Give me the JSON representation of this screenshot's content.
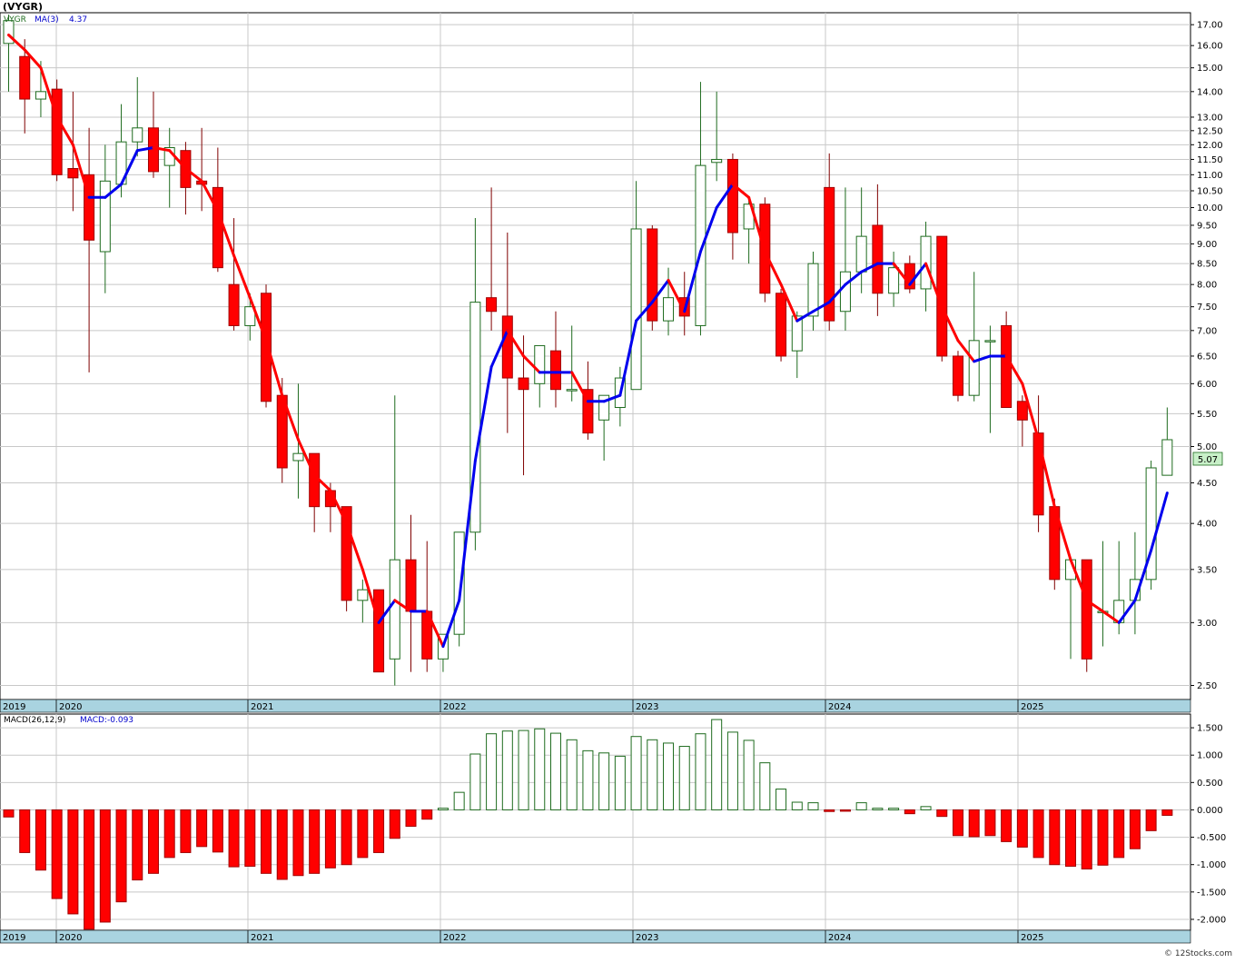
{
  "header": {
    "title": "(VYGR)",
    "legend_symbol": "VYGR",
    "legend_ma": "MA(3)",
    "legend_ma_value": "4.37",
    "last_price": "5.07",
    "watermark": "© 12Stocks.com"
  },
  "macd_panel": {
    "label": "MACD(26,12,9)",
    "value_label": "MACD:-0.093"
  },
  "colors": {
    "up": "#1e6b1e",
    "down": "#ff0000",
    "ma_up": "#0000ee",
    "ma_down": "#ff0000",
    "axis_band": "#a9d3e0",
    "grid": "#c8c8c8",
    "price_tag": "#c8f0c8"
  },
  "chart_data": [
    {
      "type": "candlestick",
      "title": "",
      "frequency": "monthly",
      "scale": "log",
      "ylim": [
        2.4,
        17.6
      ],
      "y_ticks": [
        "17.00",
        "16.00",
        "15.00",
        "14.00",
        "13.00",
        "12.50",
        "12.00",
        "11.50",
        "11.00",
        "10.50",
        "10.00",
        "9.50",
        "9.00",
        "8.50",
        "8.00",
        "7.50",
        "7.00",
        "6.50",
        "6.00",
        "5.50",
        "5.00",
        "4.50",
        "4.00",
        "3.50",
        "3.00",
        "2.50"
      ],
      "x_labels": [
        "2019",
        "2020",
        "2021",
        "2022",
        "2023",
        "2024",
        "2025"
      ],
      "series_ohlc": [
        {
          "o": 16.1,
          "h": 17.5,
          "l": 14.0,
          "c": 17.2
        },
        {
          "o": 15.5,
          "h": 16.3,
          "l": 12.4,
          "c": 13.7
        },
        {
          "o": 13.7,
          "h": 15.3,
          "l": 13.0,
          "c": 14.0
        },
        {
          "o": 14.1,
          "h": 14.5,
          "l": 10.8,
          "c": 11.0
        },
        {
          "o": 11.2,
          "h": 14.0,
          "l": 9.9,
          "c": 10.9
        },
        {
          "o": 11.0,
          "h": 12.6,
          "l": 6.2,
          "c": 9.1
        },
        {
          "o": 8.8,
          "h": 12.0,
          "l": 7.8,
          "c": 10.8
        },
        {
          "o": 10.7,
          "h": 13.5,
          "l": 10.3,
          "c": 12.1
        },
        {
          "o": 12.1,
          "h": 14.6,
          "l": 11.6,
          "c": 12.6
        },
        {
          "o": 12.6,
          "h": 14.0,
          "l": 10.9,
          "c": 11.1
        },
        {
          "o": 11.3,
          "h": 12.6,
          "l": 10.0,
          "c": 11.9
        },
        {
          "o": 11.8,
          "h": 12.1,
          "l": 9.8,
          "c": 10.6
        },
        {
          "o": 10.8,
          "h": 12.6,
          "l": 9.9,
          "c": 10.7
        },
        {
          "o": 10.6,
          "h": 11.9,
          "l": 8.3,
          "c": 8.4
        },
        {
          "o": 8.0,
          "h": 9.7,
          "l": 7.0,
          "c": 7.1
        },
        {
          "o": 7.1,
          "h": 7.8,
          "l": 6.8,
          "c": 7.5
        },
        {
          "o": 7.8,
          "h": 8.0,
          "l": 5.6,
          "c": 5.7
        },
        {
          "o": 5.8,
          "h": 6.1,
          "l": 4.5,
          "c": 4.7
        },
        {
          "o": 4.8,
          "h": 6.0,
          "l": 4.3,
          "c": 4.9
        },
        {
          "o": 4.9,
          "h": 4.9,
          "l": 3.9,
          "c": 4.2
        },
        {
          "o": 4.4,
          "h": 4.5,
          "l": 3.9,
          "c": 4.2
        },
        {
          "o": 4.2,
          "h": 4.2,
          "l": 3.1,
          "c": 3.2
        },
        {
          "o": 3.2,
          "h": 3.4,
          "l": 3.0,
          "c": 3.3
        },
        {
          "o": 3.3,
          "h": 3.3,
          "l": 2.6,
          "c": 2.6
        },
        {
          "o": 2.7,
          "h": 5.8,
          "l": 2.5,
          "c": 3.6
        },
        {
          "o": 3.6,
          "h": 4.1,
          "l": 2.6,
          "c": 3.1
        },
        {
          "o": 3.1,
          "h": 3.8,
          "l": 2.6,
          "c": 2.7
        },
        {
          "o": 2.7,
          "h": 2.9,
          "l": 2.6,
          "c": 2.9
        },
        {
          "o": 2.9,
          "h": 3.9,
          "l": 2.8,
          "c": 3.9
        },
        {
          "o": 3.9,
          "h": 9.7,
          "l": 3.7,
          "c": 7.6
        },
        {
          "o": 7.7,
          "h": 10.6,
          "l": 7.0,
          "c": 7.4
        },
        {
          "o": 7.3,
          "h": 9.3,
          "l": 5.2,
          "c": 6.1
        },
        {
          "o": 6.1,
          "h": 6.9,
          "l": 4.6,
          "c": 5.9
        },
        {
          "o": 6.0,
          "h": 6.7,
          "l": 5.6,
          "c": 6.7
        },
        {
          "o": 6.6,
          "h": 7.4,
          "l": 5.6,
          "c": 5.9
        },
        {
          "o": 5.9,
          "h": 7.1,
          "l": 5.7,
          "c": 5.9
        },
        {
          "o": 5.9,
          "h": 6.4,
          "l": 5.1,
          "c": 5.2
        },
        {
          "o": 5.4,
          "h": 5.8,
          "l": 4.8,
          "c": 5.8
        },
        {
          "o": 5.6,
          "h": 6.3,
          "l": 5.3,
          "c": 6.1
        },
        {
          "o": 5.9,
          "h": 10.8,
          "l": 5.9,
          "c": 9.4
        },
        {
          "o": 9.4,
          "h": 9.5,
          "l": 7.0,
          "c": 7.2
        },
        {
          "o": 7.2,
          "h": 8.4,
          "l": 6.9,
          "c": 7.7
        },
        {
          "o": 7.7,
          "h": 8.3,
          "l": 6.9,
          "c": 7.3
        },
        {
          "o": 7.1,
          "h": 14.4,
          "l": 6.9,
          "c": 11.3
        },
        {
          "o": 11.4,
          "h": 14.0,
          "l": 10.8,
          "c": 11.5
        },
        {
          "o": 11.5,
          "h": 11.7,
          "l": 8.6,
          "c": 9.3
        },
        {
          "o": 9.4,
          "h": 10.3,
          "l": 8.5,
          "c": 10.1
        },
        {
          "o": 10.1,
          "h": 10.3,
          "l": 7.6,
          "c": 7.8
        },
        {
          "o": 7.8,
          "h": 7.9,
          "l": 6.4,
          "c": 6.5
        },
        {
          "o": 6.6,
          "h": 7.4,
          "l": 6.1,
          "c": 7.3
        },
        {
          "o": 7.3,
          "h": 8.8,
          "l": 7.0,
          "c": 8.5
        },
        {
          "o": 10.6,
          "h": 11.7,
          "l": 7.0,
          "c": 7.2
        },
        {
          "o": 7.4,
          "h": 10.6,
          "l": 7.0,
          "c": 8.3
        },
        {
          "o": 8.3,
          "h": 10.6,
          "l": 7.8,
          "c": 9.2
        },
        {
          "o": 9.5,
          "h": 10.7,
          "l": 7.3,
          "c": 7.8
        },
        {
          "o": 7.8,
          "h": 8.8,
          "l": 7.5,
          "c": 8.4
        },
        {
          "o": 8.5,
          "h": 8.7,
          "l": 7.8,
          "c": 7.9
        },
        {
          "o": 7.9,
          "h": 9.6,
          "l": 7.4,
          "c": 9.2
        },
        {
          "o": 9.2,
          "h": 9.2,
          "l": 6.4,
          "c": 6.5
        },
        {
          "o": 6.5,
          "h": 6.6,
          "l": 5.7,
          "c": 5.8
        },
        {
          "o": 5.8,
          "h": 8.3,
          "l": 5.7,
          "c": 6.8
        },
        {
          "o": 6.8,
          "h": 7.1,
          "l": 5.2,
          "c": 6.8
        },
        {
          "o": 7.1,
          "h": 7.4,
          "l": 5.6,
          "c": 5.6
        },
        {
          "o": 5.7,
          "h": 5.8,
          "l": 5.0,
          "c": 5.4
        },
        {
          "o": 5.2,
          "h": 5.8,
          "l": 3.9,
          "c": 4.1
        },
        {
          "o": 4.2,
          "h": 4.3,
          "l": 3.3,
          "c": 3.4
        },
        {
          "o": 3.4,
          "h": 3.6,
          "l": 2.7,
          "c": 3.6
        },
        {
          "o": 3.6,
          "h": 3.6,
          "l": 2.6,
          "c": 2.7
        },
        {
          "o": 3.1,
          "h": 3.8,
          "l": 2.8,
          "c": 3.1
        },
        {
          "o": 3.0,
          "h": 3.8,
          "l": 2.9,
          "c": 3.2
        },
        {
          "o": 3.2,
          "h": 3.9,
          "l": 2.9,
          "c": 3.4
        },
        {
          "o": 3.4,
          "h": 4.8,
          "l": 3.3,
          "c": 4.7
        },
        {
          "o": 4.6,
          "h": 5.6,
          "l": 4.6,
          "c": 5.1
        }
      ],
      "ma3": [
        16.5,
        15.8,
        15.0,
        13.0,
        12.0,
        10.3,
        10.3,
        10.7,
        11.8,
        11.9,
        11.8,
        11.2,
        10.8,
        9.9,
        8.7,
        7.7,
        6.8,
        5.8,
        5.1,
        4.6,
        4.4,
        4.0,
        3.5,
        3.0,
        3.2,
        3.1,
        3.1,
        2.8,
        3.2,
        4.8,
        6.3,
        7.0,
        6.5,
        6.2,
        6.2,
        6.2,
        5.7,
        5.7,
        5.8,
        7.2,
        7.6,
        8.1,
        7.4,
        8.8,
        10.0,
        10.7,
        10.3,
        8.8,
        8.0,
        7.2,
        7.4,
        7.6,
        8.0,
        8.3,
        8.5,
        8.5,
        8.0,
        8.5,
        7.5,
        6.8,
        6.4,
        6.5,
        6.5,
        6.0,
        5.1,
        4.2,
        3.6,
        3.2,
        3.1,
        3.0,
        3.2,
        3.7,
        4.37
      ]
    },
    {
      "type": "bar",
      "title": "MACD(26,12,9)",
      "ylim": [
        -2.2,
        1.75
      ],
      "y_ticks": [
        "1.500",
        "1.000",
        "0.500",
        "0.000",
        "-0.500",
        "-1.000",
        "-1.500",
        "-2.000"
      ],
      "x_labels": [
        "2019",
        "2020",
        "2021",
        "2022",
        "2023",
        "2024",
        "2025"
      ],
      "values": [
        -0.13,
        -0.78,
        -1.1,
        -1.62,
        -1.9,
        -2.18,
        -2.05,
        -1.68,
        -1.28,
        -1.16,
        -0.87,
        -0.78,
        -0.67,
        -0.77,
        -1.04,
        -1.03,
        -1.16,
        -1.27,
        -1.2,
        -1.16,
        -1.06,
        -1.0,
        -0.87,
        -0.78,
        -0.52,
        -0.3,
        -0.17,
        0.03,
        0.32,
        1.02,
        1.39,
        1.44,
        1.45,
        1.48,
        1.4,
        1.28,
        1.08,
        1.04,
        0.98,
        1.34,
        1.28,
        1.22,
        1.16,
        1.39,
        1.65,
        1.42,
        1.27,
        0.86,
        0.38,
        0.14,
        0.13,
        -0.03,
        -0.02,
        0.13,
        0.03,
        0.03,
        -0.07,
        0.06,
        -0.12,
        -0.47,
        -0.49,
        -0.47,
        -0.58,
        -0.68,
        -0.87,
        -1.0,
        -1.03,
        -1.08,
        -1.01,
        -0.87,
        -0.71,
        -0.38,
        -0.1
      ]
    }
  ]
}
